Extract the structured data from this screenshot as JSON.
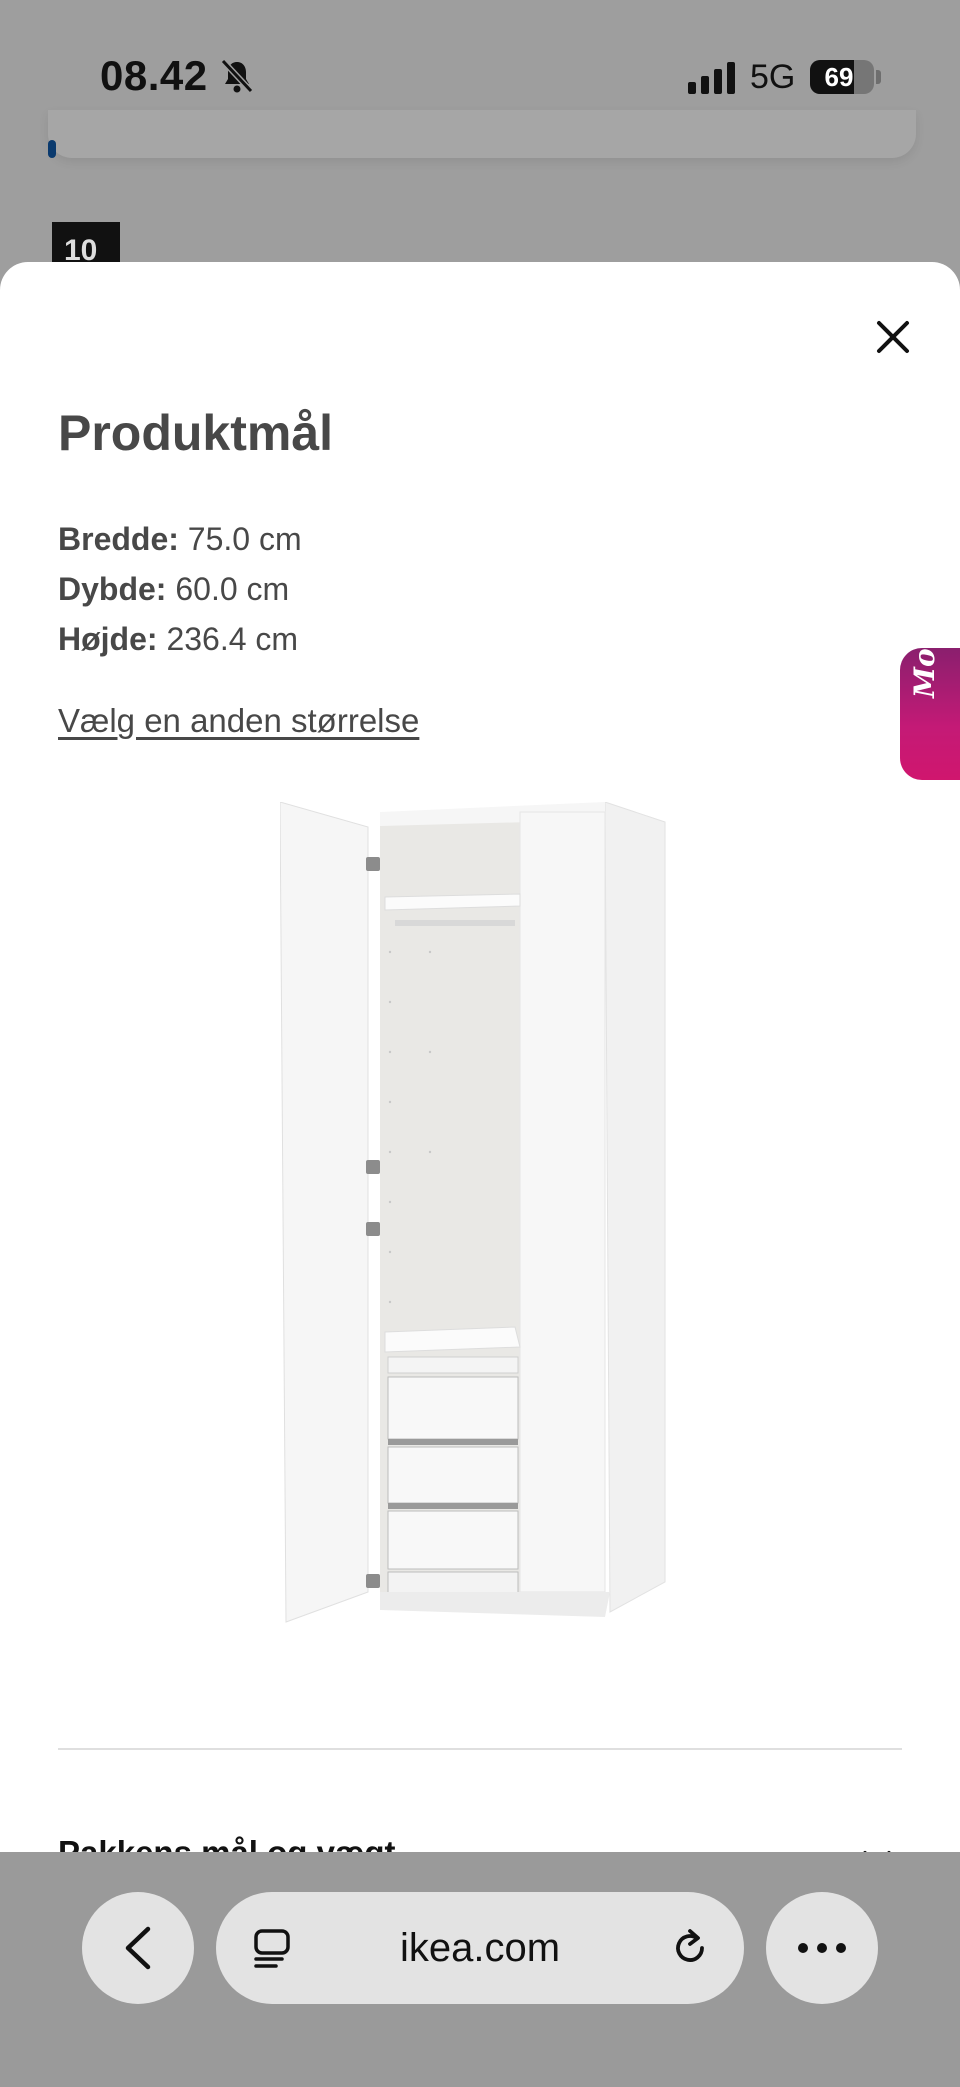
{
  "status_bar": {
    "time": "08.42",
    "network": "5G",
    "battery": "69",
    "battery_level": 0.69,
    "icons": [
      "bell-slash-icon",
      "signal-icon",
      "battery-icon"
    ]
  },
  "background_page": {
    "badge": "10"
  },
  "modal": {
    "title": "Produktmål",
    "dimensions": [
      {
        "label": "Bredde:",
        "value": "75.0 cm"
      },
      {
        "label": "Dybde:",
        "value": "60.0 cm"
      },
      {
        "label": "Højde:",
        "value": "236.4 cm"
      }
    ],
    "size_link": "Vælg en anden størrelse",
    "accordion_label": "Pakkens mål og vægt",
    "close_icon": "close-icon",
    "chevron_icon": "chevron-down-icon"
  },
  "molly": {
    "label": "Molly",
    "accent": "#c41a76"
  },
  "browser": {
    "url": "ikea.com",
    "icons": [
      "chevron-left-icon",
      "tabs-icon",
      "reload-icon",
      "more-icon"
    ]
  }
}
